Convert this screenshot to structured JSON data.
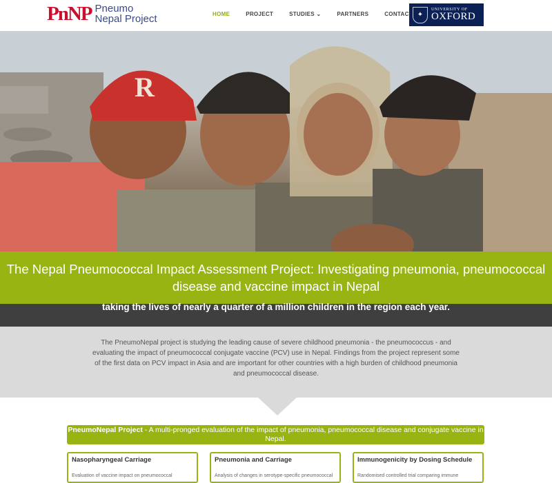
{
  "logo": {
    "mark": "PnNP",
    "line1": "Pneumo",
    "line2": "Nepal Project"
  },
  "nav": [
    {
      "label": "HOME",
      "active": true
    },
    {
      "label": "PROJECT"
    },
    {
      "label": "STUDIES ⌄"
    },
    {
      "label": "PARTNERS"
    },
    {
      "label": "CONTACT"
    }
  ],
  "oxford": {
    "line1": "UNIVERSITY OF",
    "line2": "OXFORD"
  },
  "hero": {
    "title": "The Nepal Pneumococcal Impact Assessment Project: Investigating pneumonia, pneumococcal disease and vaccine impact in Nepal"
  },
  "dark_band": {
    "text": "taking the lives of nearly a quarter of a million children in the region each year."
  },
  "intro": {
    "text": "The PneumoNepal project is studying the leading cause of severe childhood pneumonia - the pneumococcus - and evaluating the impact of pneumococcal conjugate vaccine (PCV) use in Nepal. Findings from the project represent some of the first data on PCV impact in Asia and are important for other countries with a high burden of childhood pneumonia and pneumococcal disease."
  },
  "project_bar": {
    "bold": "PneumoNepal Project",
    "text": " - A multi-pronged evaluation of the impact of pneumonia, pneumococcal disease and conjugate vaccine in Nepal."
  },
  "cards": [
    {
      "title": "Nasopharyngeal Carriage",
      "text": "Evaluation of vaccine impact on pneumococcal"
    },
    {
      "title": "Pneumonia and Carriage",
      "text": "Analysis of changes in serotype-specific pneumococcal"
    },
    {
      "title": "Immunogenicity by Dosing Schedule",
      "text": "Randomised controlled trial comparing immune"
    }
  ],
  "colors": {
    "accent": "#98b413",
    "brand_red": "#c8102e",
    "oxford_blue": "#0b2156"
  }
}
